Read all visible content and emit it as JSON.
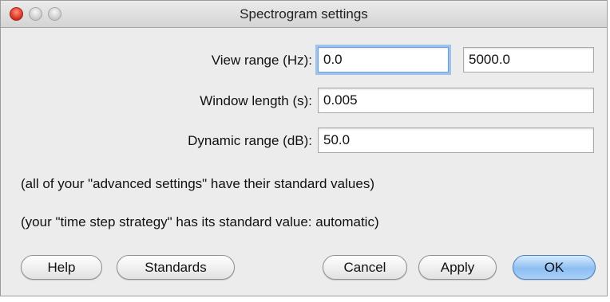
{
  "window": {
    "title": "Spectrogram settings"
  },
  "fields": {
    "view_range_label": "View range (Hz):",
    "view_range_from": "0.0",
    "view_range_to": "5000.0",
    "window_length_label": "Window length (s):",
    "window_length": "0.005",
    "dynamic_range_label": "Dynamic range (dB):",
    "dynamic_range": "50.0"
  },
  "notes": {
    "advanced": "(all of your \"advanced settings\" have their standard values)",
    "time_step": "(your \"time step strategy\" has its standard value: automatic)"
  },
  "buttons": {
    "help": "Help",
    "standards": "Standards",
    "cancel": "Cancel",
    "apply": "Apply",
    "ok": "OK"
  },
  "colors": {
    "focus_ring": "#9cc2ee",
    "default_button": "#8dbef2",
    "close_button": "#d62a1c"
  }
}
